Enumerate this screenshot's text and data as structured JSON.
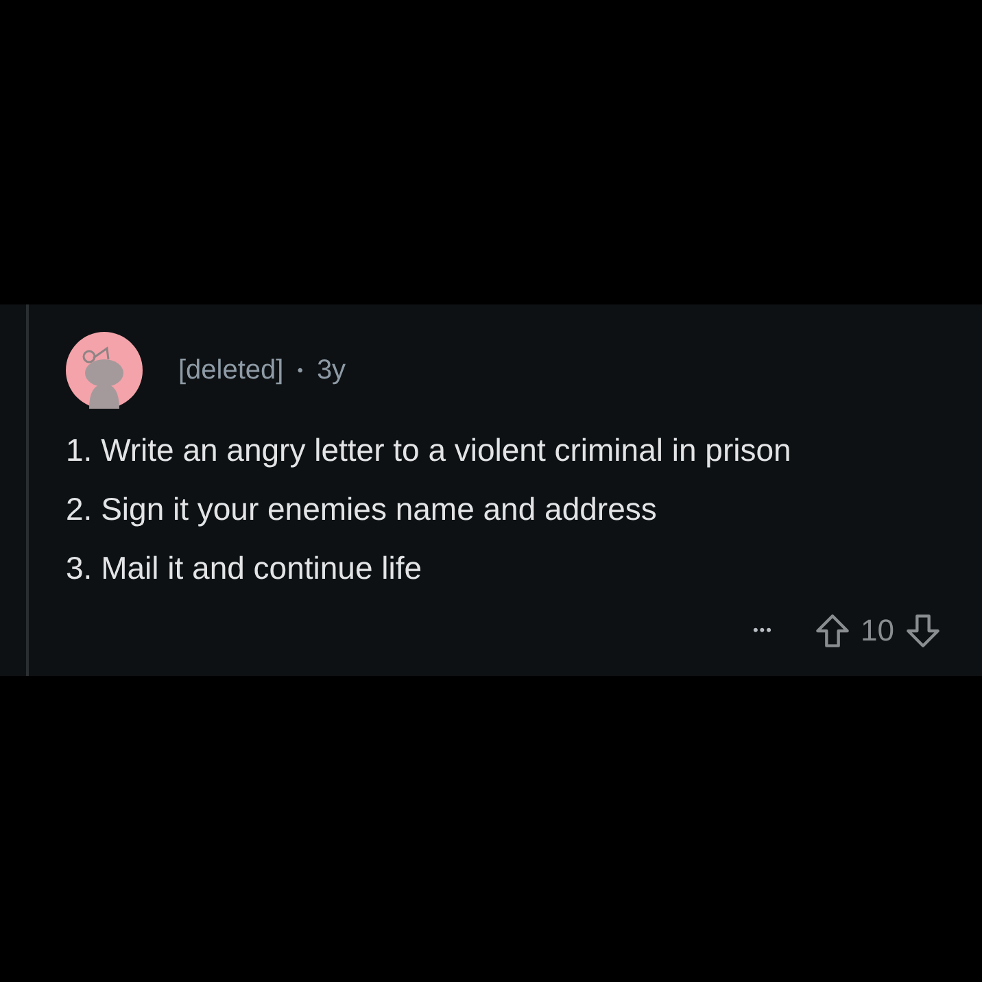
{
  "comment": {
    "author": "[deleted]",
    "separator": "•",
    "age": "3y",
    "lines": [
      "1. Write an angry letter to a violent criminal in prison",
      "2. Sign it your enemies name and address",
      "3. Mail it and continue life"
    ],
    "more": "•••",
    "score": "10"
  }
}
